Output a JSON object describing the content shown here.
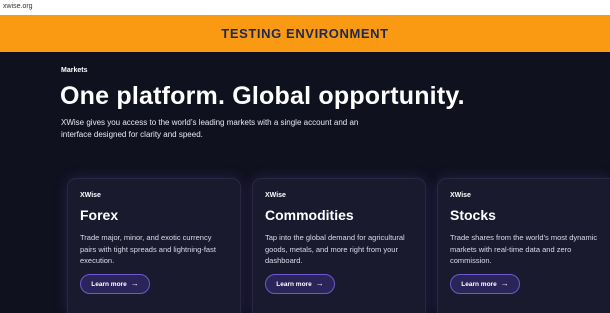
{
  "browser": {
    "url": "xwise.org"
  },
  "banner": {
    "text": "TESTING ENVIRONMENT"
  },
  "hero": {
    "section_label": "Markets",
    "title": "One platform. Global opportunity.",
    "description": "XWise gives you access to the world’s leading markets with a single account and an interface designed for clarity and speed."
  },
  "cards": [
    {
      "brand": "XWise",
      "title": "Forex",
      "description": "Trade major, minor, and exotic currency pairs with tight spreads and lightning-fast execution.",
      "button_label": "Learn more",
      "button_icon": "arrow-right-icon"
    },
    {
      "brand": "XWise",
      "title": "Commodities",
      "description": "Tap into the global demand for agricultural goods, metals, and more right from your dashboard.",
      "button_label": "Learn more",
      "button_icon": "arrow-right-icon"
    },
    {
      "brand": "XWise",
      "title": "Stocks",
      "description": "Trade shares from the world’s most dynamic markets with real-time data and zero commission.",
      "button_label": "Learn more",
      "button_icon": "arrow-right-icon"
    }
  ],
  "colors": {
    "background": "#10111f",
    "banner": "#f99a12",
    "banner_text": "#1e2a4d",
    "card": "#191a2e",
    "button_border": "#6a5acd"
  }
}
